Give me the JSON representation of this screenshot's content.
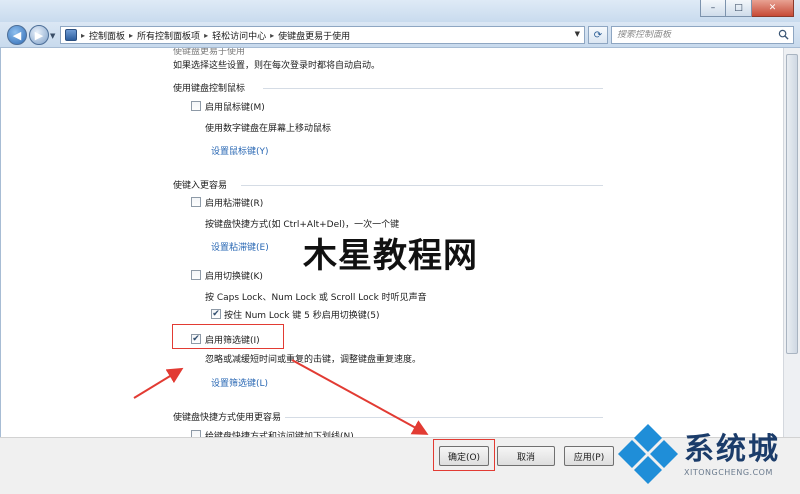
{
  "window": {
    "minimize": "–",
    "maximize": "□",
    "close": "✕"
  },
  "address": {
    "breadcrumbs": [
      "控制面板",
      "所有控制面板项",
      "轻松访问中心",
      "使键盘更易于使用"
    ],
    "search_placeholder": "搜索控制面板"
  },
  "content": {
    "top_title": "使键盘更易于使用",
    "top_note": "如果选择这些设置，则在每次登录时都将自动启动。",
    "section_mouse": {
      "title": "使用键盘控制鼠标",
      "mouse_keys": {
        "label": "启用鼠标键(M)",
        "checked": false
      },
      "mouse_keys_desc": "使用数字键盘在屏幕上移动鼠标",
      "mouse_keys_link": "设置鼠标键(Y)"
    },
    "section_typing": {
      "title": "使键入更容易",
      "sticky_keys": {
        "label": "启用粘滞键(R)",
        "checked": false
      },
      "sticky_keys_desc": "按键盘快捷方式(如 Ctrl+Alt+Del)，一次一个键",
      "sticky_keys_link": "设置粘滞键(E)",
      "toggle_keys": {
        "label": "启用切换键(K)",
        "checked": false
      },
      "toggle_keys_desc": "按 Caps Lock、Num Lock 或 Scroll Lock 时听见声音",
      "toggle_keys_hold": {
        "label": "按住 Num Lock 键 5 秒启用切换键(5)",
        "checked": true
      },
      "filter_keys": {
        "label": "启用筛选键(I)",
        "checked": true
      },
      "filter_keys_desc": "忽略或减缓短时间或重复的击键，调整键盘重复速度。",
      "filter_keys_link": "设置筛选键(L)"
    },
    "section_shortcuts": {
      "title": "使键盘快捷方式使用更容易",
      "underline": {
        "label": "给键盘快捷方式和访问键加下划线(N)",
        "checked": false
      }
    }
  },
  "footer": {
    "ok": "确定(O)",
    "cancel": "取消",
    "apply": "应用(P)"
  },
  "watermark": "木星教程网",
  "logo": {
    "cn": "系统城",
    "en": "XITONGCHENG.COM"
  },
  "colors": {
    "annotation_red": "#e23b33",
    "link_blue": "#2a68b4"
  }
}
